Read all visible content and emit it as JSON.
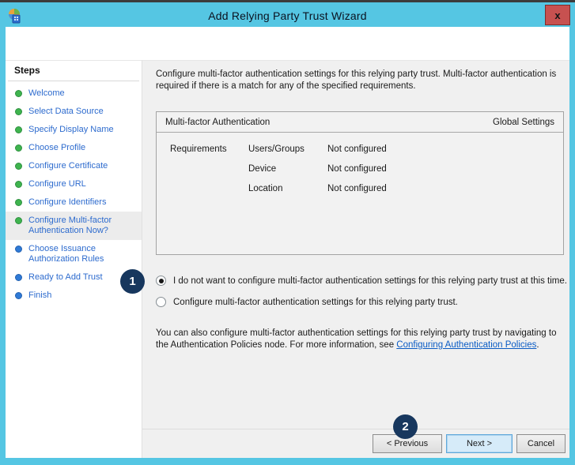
{
  "window": {
    "title": "Add Relying Party Trust Wizard",
    "close_label": "x"
  },
  "colors": {
    "titlebar": "#55c6e3",
    "close_bg": "#c75150",
    "badge": "#17375e",
    "step_link": "#2d6bce",
    "dot_done": "#3fb44e",
    "dot_todo": "#2f7ad6",
    "link": "#0a5bc4",
    "next_bg": "#d6ebf9",
    "next_border": "#5ea7da",
    "content_bg": "#f0f0f0"
  },
  "steps": {
    "header": "Steps",
    "items": [
      {
        "label": "Welcome",
        "status": "done"
      },
      {
        "label": "Select Data Source",
        "status": "done"
      },
      {
        "label": "Specify Display Name",
        "status": "done"
      },
      {
        "label": "Choose Profile",
        "status": "done"
      },
      {
        "label": "Configure Certificate",
        "status": "done"
      },
      {
        "label": "Configure URL",
        "status": "done"
      },
      {
        "label": "Configure Identifiers",
        "status": "done"
      },
      {
        "label": "Configure Multi-factor Authentication Now?",
        "status": "done",
        "current": true
      },
      {
        "label": "Choose Issuance Authorization Rules",
        "status": "todo"
      },
      {
        "label": "Ready to Add Trust",
        "status": "todo"
      },
      {
        "label": "Finish",
        "status": "todo"
      }
    ]
  },
  "content": {
    "intro": "Configure multi-factor authentication settings for this relying party trust. Multi-factor authentication is required if there is a match for any of the specified requirements.",
    "mfa_box": {
      "title": "Multi-factor Authentication",
      "right_label": "Global Settings",
      "row_header": "Requirements",
      "rows": [
        {
          "name": "Users/Groups",
          "value": "Not configured"
        },
        {
          "name": "Device",
          "value": "Not configured"
        },
        {
          "name": "Location",
          "value": "Not configured"
        }
      ]
    },
    "radio_skip": "I do not want to configure multi-factor authentication settings for this relying party trust at this time.",
    "radio_configure": "Configure multi-factor authentication settings for this relying party trust.",
    "footnote_before": "You can also configure multi-factor authentication settings for this relying party trust by navigating to the Authentication Policies node. For more information, see ",
    "footnote_link": "Configuring Authentication Policies",
    "footnote_after": "."
  },
  "badges": {
    "one": "1",
    "two": "2"
  },
  "buttons": {
    "previous": "< Previous",
    "next": "Next >",
    "cancel": "Cancel"
  }
}
